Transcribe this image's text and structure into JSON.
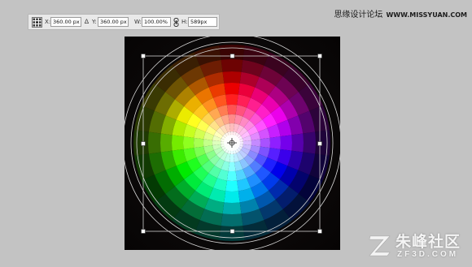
{
  "options_bar": {
    "x_label": "X:",
    "x_value": "360.00 px",
    "y_label": "Y:",
    "y_value": "360.00 px",
    "w_label": "W:",
    "w_value": "100.00%",
    "h_label": "H:",
    "h_value": "589px",
    "icons": [
      "reference-point-icon",
      "delta-icon",
      "link-icon"
    ]
  },
  "watermark_top": {
    "site_cn": "思缘设计论坛",
    "site_url": "WWW.MISSYUAN.COM"
  },
  "watermark_bottom": {
    "brand_cn": "朱峰社区",
    "brand_en": "ZF3D.COM"
  },
  "colors": {
    "background": "#c3c3c3",
    "canvas": "#060404",
    "guide_lines": "#d8d8d8"
  }
}
